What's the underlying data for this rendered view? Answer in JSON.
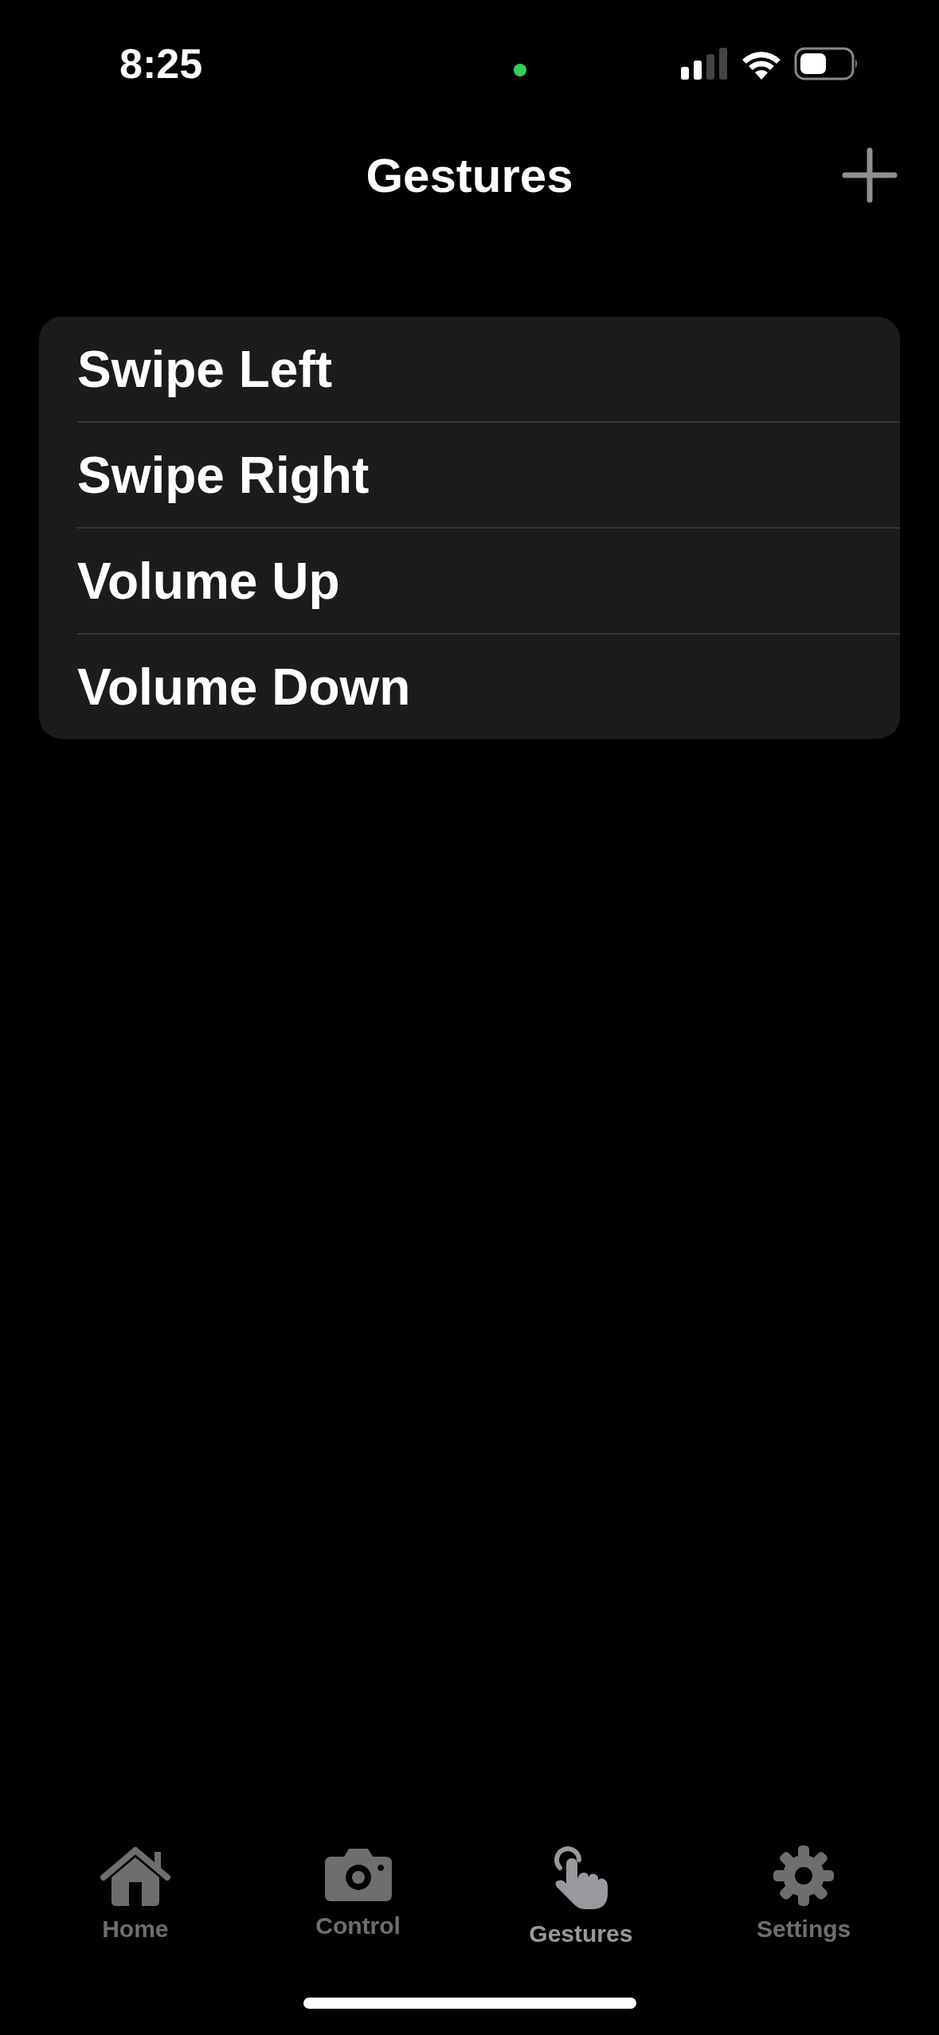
{
  "status_bar": {
    "time": "8:25"
  },
  "nav": {
    "title": "Gestures"
  },
  "gestures": [
    {
      "label": "Swipe Left"
    },
    {
      "label": "Swipe Right"
    },
    {
      "label": "Volume Up"
    },
    {
      "label": "Volume Down"
    }
  ],
  "tabs": [
    {
      "label": "Home",
      "kind": "home",
      "selected": false
    },
    {
      "label": "Control",
      "kind": "camera",
      "selected": false
    },
    {
      "label": "Gestures",
      "kind": "hand",
      "selected": true
    },
    {
      "label": "Settings",
      "kind": "gear",
      "selected": false
    }
  ]
}
